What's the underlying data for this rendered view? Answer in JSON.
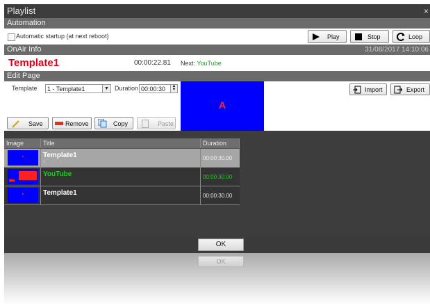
{
  "window": {
    "title": "Playlist",
    "close_glyph": "×"
  },
  "automation": {
    "header": "Automation",
    "startup_label": "Automatic startup (at next reboot)",
    "play_label": "Play",
    "stop_label": "Stop",
    "loop_label": "Loop"
  },
  "onair": {
    "header": "OnAir Info",
    "datetime": "31/08/2017 14:10:06",
    "current_name": "Template1",
    "current_duration": "00:00:22.81",
    "next_label": "Next:",
    "next_value": "YouTube"
  },
  "edit": {
    "header": "Edit Page",
    "template_label": "Template",
    "template_value": "1 - Template1",
    "duration_label": "Duration",
    "duration_value": "00:00:30",
    "preview_text": "A",
    "import_label": "Import",
    "export_label": "Export",
    "save_label": "Save",
    "remove_label": "Remove",
    "copy_label": "Copy",
    "paste_label": "Paste"
  },
  "playlist": {
    "columns": [
      "Image",
      "Title",
      "Duration"
    ],
    "rows": [
      {
        "title": "Template1",
        "sub": "1",
        "duration": "00:00:30.00",
        "state": "selected"
      },
      {
        "title": "YouTube",
        "sub": "",
        "duration": "00:00:30.00",
        "state": "next"
      },
      {
        "title": "Template1",
        "sub": "",
        "duration": "00:00:30.00",
        "state": "normal"
      }
    ]
  },
  "footer": {
    "ok_label": "OK"
  },
  "colors": {
    "accent_red": "#e0001b",
    "next_green": "#1aa31a",
    "preview_blue": "#0000ff"
  }
}
